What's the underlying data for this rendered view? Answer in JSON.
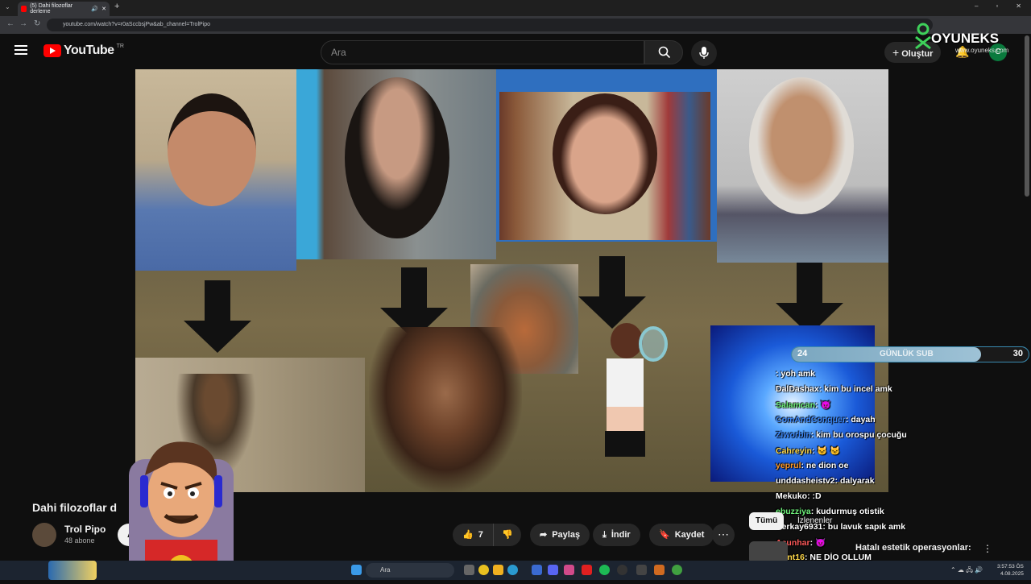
{
  "browser": {
    "tab_title": "(5) Dahi filozoflar derleme",
    "url": "youtube.com/watch?v=r0aSccbsjPw&ab_channel=TrolPipo"
  },
  "header": {
    "logo_text": "YouTube",
    "country_code": "TR",
    "search_placeholder": "Ara",
    "create_label": "Oluştur",
    "avatar_letter": "C"
  },
  "video": {
    "title": "Dahi filozoflar d",
    "channel_name": "Trol Pipo",
    "subscribers": "48 abone",
    "subscribe_label": "A",
    "like_count": "7",
    "share_label": "Paylaş",
    "download_label": "İndir",
    "save_label": "Kaydet"
  },
  "sidebar": {
    "chip_all": "Tümü",
    "chip_watched": "İzlenenler",
    "rec_title": "Hatalı estetik operasyonlar:"
  },
  "overlay": {
    "brand": "OYUNEKS",
    "brand_site": "www.oyuneks.com",
    "sub_bar": {
      "current": "24",
      "label": "GÜNLÜK SUB",
      "goal": "30",
      "progress": 0.8
    },
    "chat": [
      {
        "user": "",
        "msg": ": yoh amk",
        "color": "#ff5a5a"
      },
      {
        "user": "DalDashax",
        "msg": ": kim bu incel amk",
        "color": "#ffffff"
      },
      {
        "user": "Salamcan",
        "msg": ": 😈",
        "color": "#6ef07a"
      },
      {
        "user": "ComAndConquer",
        "msg": ": dayah",
        "color": "#3e8bff"
      },
      {
        "user": "Ziworbin",
        "msg": ": kim bu orospu çocuğu",
        "color": "#3e8bff"
      },
      {
        "user": "Cahreyin",
        "msg": ": 🐱 🐱",
        "color": "#ffd84a"
      },
      {
        "user": "yeprul",
        "msg": ": ne dion oe",
        "color": "#ff9a2a"
      },
      {
        "user": "unddasheistv2",
        "msg": ": dalyarak",
        "color": "#ffffff"
      },
      {
        "user": "Mekuko",
        "msg": ": :D",
        "color": "#ffffff"
      },
      {
        "user": "ebuzziya",
        "msg": ": kudurmuş otistik",
        "color": "#6ef07a"
      },
      {
        "user": "Berkay6931",
        "msg": ": bu lavuk sapık amk",
        "color": "#ffffff"
      },
      {
        "user": "Asunhar",
        "msg": ": 😈",
        "color": "#ff5a5a"
      },
      {
        "user": "Taint16",
        "msg": ": NE DİO OLLUM",
        "color": "#ffd84a"
      }
    ]
  },
  "taskbar": {
    "search_placeholder": "Ara",
    "time": "3:57:53 ÖS",
    "date": "4.08.2025"
  }
}
